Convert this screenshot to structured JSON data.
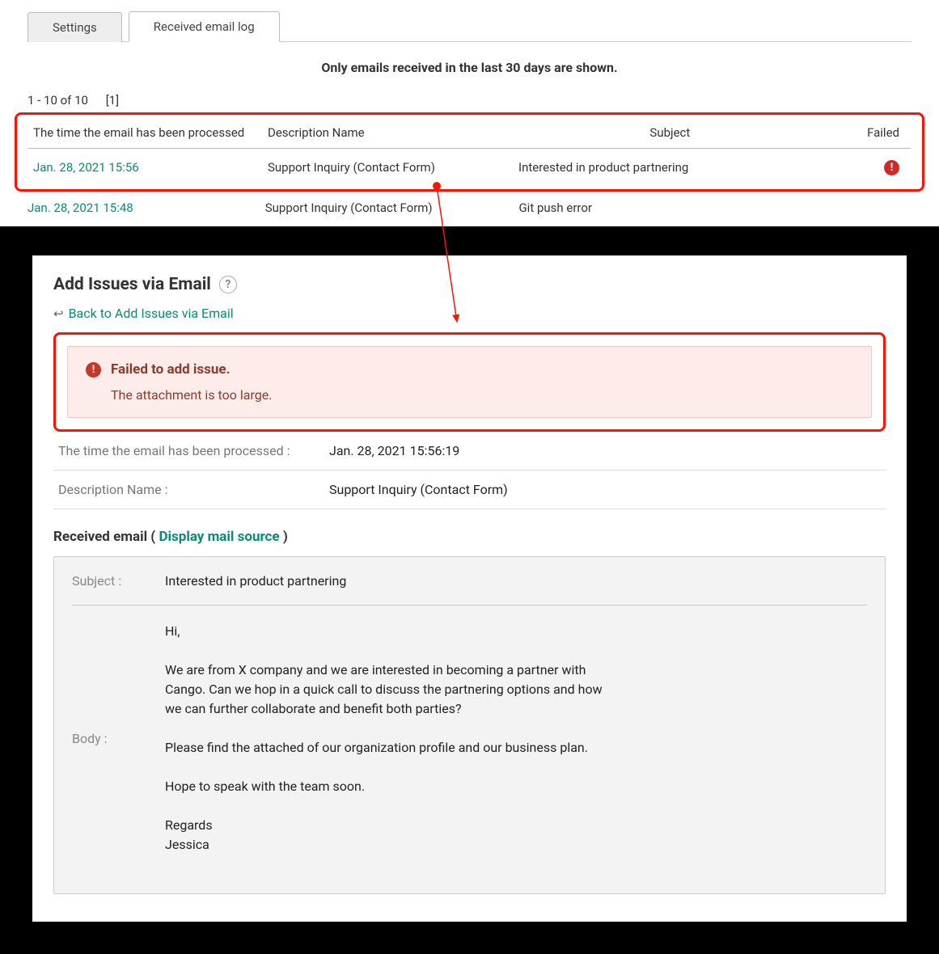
{
  "top": {
    "tabs": {
      "settings": "Settings",
      "received": "Received email log"
    },
    "notice": "Only emails received in the last 30 days are shown.",
    "pager_range": "1 - 10 of 10",
    "pager_page": "[1]",
    "columns": {
      "time": "The time the email has been processed",
      "desc": "Description Name",
      "subject": "Subject",
      "failed": "Failed"
    },
    "rows": [
      {
        "time": "Jan. 28, 2021 15:56",
        "desc": "Support Inquiry (Contact Form)",
        "subject": "Interested in product partnering",
        "failed": true
      },
      {
        "time": "Jan. 28, 2021 15:48",
        "desc": "Support Inquiry (Contact Form)",
        "subject": "Git push error",
        "failed": false
      }
    ]
  },
  "detail": {
    "title": "Add Issues via Email",
    "back": "Back to Add Issues via Email",
    "alert_title": "Failed to add issue.",
    "alert_msg": "The attachment is too large.",
    "kv": {
      "time_label": "The time the email has been processed :",
      "time_value": "Jan. 28, 2021 15:56:19",
      "desc_label": "Description Name :",
      "desc_value": "Support Inquiry (Contact Form)"
    },
    "section": {
      "prefix": "Received email ( ",
      "link": "Display mail source",
      "suffix": " )"
    },
    "mail": {
      "subject_label": "Subject :",
      "subject_value": "Interested in product partnering",
      "body_label": "Body :",
      "body_value": "Hi,\n\nWe are from X company and we are interested in becoming a partner with Cango. Can we hop in a quick call to discuss the partnering options and how we can further collaborate and benefit both parties?\n\nPlease find the attached of our organization profile and our business plan.\n\nHope to speak with the team soon.\n\nRegards\nJessica"
    }
  }
}
